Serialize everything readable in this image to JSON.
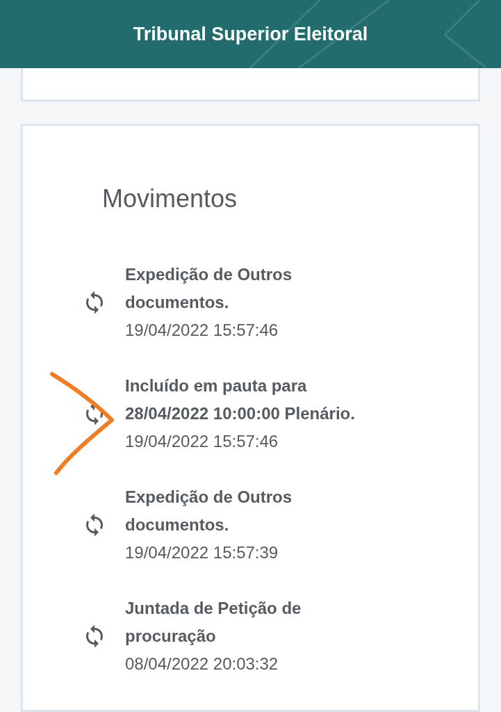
{
  "header": {
    "title": "Tribunal Superior Eleitoral"
  },
  "movimentos": {
    "title": "Movimentos",
    "items": [
      {
        "text": "Expedição de Outros documentos.",
        "date": "19/04/2022 15:57:46"
      },
      {
        "text": "Incluído em pauta para 28/04/2022 10:00:00 Plenário.",
        "date": "19/04/2022 15:57:46"
      },
      {
        "text": "Expedição de Outros documentos.",
        "date": "19/04/2022 15:57:39"
      },
      {
        "text": "Juntada de Petição de procuração",
        "date": "08/04/2022 20:03:32"
      }
    ]
  }
}
